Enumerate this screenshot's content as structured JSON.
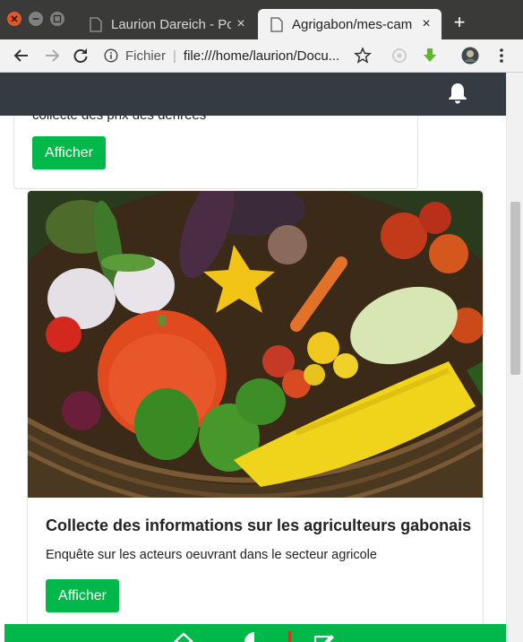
{
  "browser": {
    "tabs": [
      {
        "title": "Laurion Dareich - Po",
        "close": "×"
      },
      {
        "title": "Agrigabon/mes-cam",
        "close": "×"
      }
    ],
    "new_tab": "+",
    "omnibox": {
      "scheme_label": "Fichier",
      "separator": "|",
      "url": "file:///home/laurion/Docu..."
    }
  },
  "cards": [
    {
      "description": "collecte des prix des denrées",
      "button": "Afficher"
    },
    {
      "image": "vegetable-basket-photo",
      "title": "Collecte des informations sur les agriculteurs gabonais",
      "description": "Enquête sur les acteurs oeuvrant dans le secteur agricole",
      "button": "Afficher"
    }
  ],
  "colors": {
    "nav_bg": "#353b43",
    "accent_green": "#00b84a",
    "tab_bar": "#3a3a38"
  },
  "icons": {
    "app_nav": [
      "bell-icon"
    ],
    "bottom_nav": [
      "home-icon",
      "pie-chart-icon",
      "edit-icon"
    ],
    "toolbar": [
      "back-icon",
      "forward-icon",
      "reload-icon",
      "info-icon",
      "star-icon",
      "extension-icon",
      "download-icon",
      "profile-avatar",
      "menu-icon"
    ]
  }
}
